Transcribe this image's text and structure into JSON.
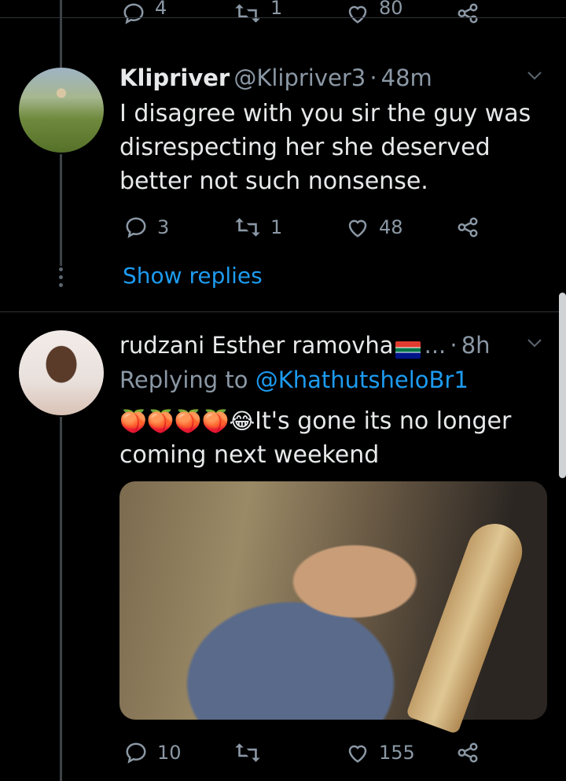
{
  "top_bar": {
    "reply_count": "4",
    "retweet_count": "1",
    "like_count": "80"
  },
  "tweet1": {
    "display_name": "Klipriver",
    "handle": "@Klipriver3",
    "separator": "·",
    "time": "48m",
    "text": "I disagree with you sir the guy was disrespecting her she deserved better not such nonsense.",
    "reply_count": "3",
    "retweet_count": "1",
    "like_count": "48",
    "show_replies": "Show replies"
  },
  "tweet2": {
    "display_name": "rudzani Esther ramovha",
    "ellipsis": "...",
    "separator": "·",
    "time": "8h",
    "replying_prefix": "Replying to",
    "replying_handle": "@KhathutsheloBr1",
    "emojis": "🍑🍑🍑🍑😂",
    "text": "It's gone its no longer coming next weekend",
    "reply_count": "10",
    "retweet_count": "",
    "like_count": "155"
  },
  "icons": {
    "reply": "reply-icon",
    "retweet": "retweet-icon",
    "like": "heart-icon",
    "share": "share-icon",
    "more": "chevron-down-icon"
  },
  "colors": {
    "background": "#000000",
    "link": "#1d9bf0",
    "muted": "#8b98a5",
    "text": "#e7e9ea"
  }
}
